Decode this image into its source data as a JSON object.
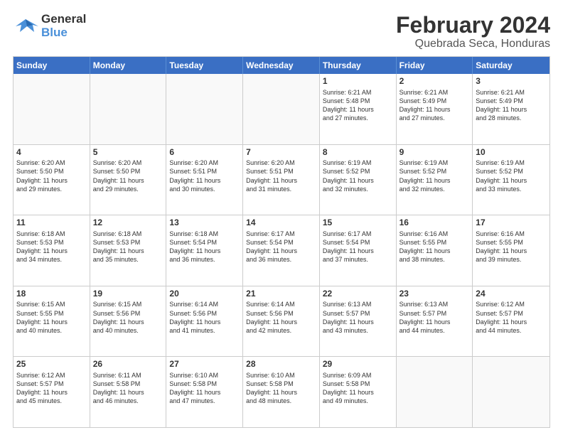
{
  "header": {
    "logo_line1": "General",
    "logo_line2": "Blue",
    "month": "February 2024",
    "location": "Quebrada Seca, Honduras"
  },
  "weekdays": [
    "Sunday",
    "Monday",
    "Tuesday",
    "Wednesday",
    "Thursday",
    "Friday",
    "Saturday"
  ],
  "weeks": [
    [
      {
        "day": "",
        "info": ""
      },
      {
        "day": "",
        "info": ""
      },
      {
        "day": "",
        "info": ""
      },
      {
        "day": "",
        "info": ""
      },
      {
        "day": "1",
        "info": "Sunrise: 6:21 AM\nSunset: 5:48 PM\nDaylight: 11 hours\nand 27 minutes."
      },
      {
        "day": "2",
        "info": "Sunrise: 6:21 AM\nSunset: 5:49 PM\nDaylight: 11 hours\nand 27 minutes."
      },
      {
        "day": "3",
        "info": "Sunrise: 6:21 AM\nSunset: 5:49 PM\nDaylight: 11 hours\nand 28 minutes."
      }
    ],
    [
      {
        "day": "4",
        "info": "Sunrise: 6:20 AM\nSunset: 5:50 PM\nDaylight: 11 hours\nand 29 minutes."
      },
      {
        "day": "5",
        "info": "Sunrise: 6:20 AM\nSunset: 5:50 PM\nDaylight: 11 hours\nand 29 minutes."
      },
      {
        "day": "6",
        "info": "Sunrise: 6:20 AM\nSunset: 5:51 PM\nDaylight: 11 hours\nand 30 minutes."
      },
      {
        "day": "7",
        "info": "Sunrise: 6:20 AM\nSunset: 5:51 PM\nDaylight: 11 hours\nand 31 minutes."
      },
      {
        "day": "8",
        "info": "Sunrise: 6:19 AM\nSunset: 5:52 PM\nDaylight: 11 hours\nand 32 minutes."
      },
      {
        "day": "9",
        "info": "Sunrise: 6:19 AM\nSunset: 5:52 PM\nDaylight: 11 hours\nand 32 minutes."
      },
      {
        "day": "10",
        "info": "Sunrise: 6:19 AM\nSunset: 5:52 PM\nDaylight: 11 hours\nand 33 minutes."
      }
    ],
    [
      {
        "day": "11",
        "info": "Sunrise: 6:18 AM\nSunset: 5:53 PM\nDaylight: 11 hours\nand 34 minutes."
      },
      {
        "day": "12",
        "info": "Sunrise: 6:18 AM\nSunset: 5:53 PM\nDaylight: 11 hours\nand 35 minutes."
      },
      {
        "day": "13",
        "info": "Sunrise: 6:18 AM\nSunset: 5:54 PM\nDaylight: 11 hours\nand 36 minutes."
      },
      {
        "day": "14",
        "info": "Sunrise: 6:17 AM\nSunset: 5:54 PM\nDaylight: 11 hours\nand 36 minutes."
      },
      {
        "day": "15",
        "info": "Sunrise: 6:17 AM\nSunset: 5:54 PM\nDaylight: 11 hours\nand 37 minutes."
      },
      {
        "day": "16",
        "info": "Sunrise: 6:16 AM\nSunset: 5:55 PM\nDaylight: 11 hours\nand 38 minutes."
      },
      {
        "day": "17",
        "info": "Sunrise: 6:16 AM\nSunset: 5:55 PM\nDaylight: 11 hours\nand 39 minutes."
      }
    ],
    [
      {
        "day": "18",
        "info": "Sunrise: 6:15 AM\nSunset: 5:55 PM\nDaylight: 11 hours\nand 40 minutes."
      },
      {
        "day": "19",
        "info": "Sunrise: 6:15 AM\nSunset: 5:56 PM\nDaylight: 11 hours\nand 40 minutes."
      },
      {
        "day": "20",
        "info": "Sunrise: 6:14 AM\nSunset: 5:56 PM\nDaylight: 11 hours\nand 41 minutes."
      },
      {
        "day": "21",
        "info": "Sunrise: 6:14 AM\nSunset: 5:56 PM\nDaylight: 11 hours\nand 42 minutes."
      },
      {
        "day": "22",
        "info": "Sunrise: 6:13 AM\nSunset: 5:57 PM\nDaylight: 11 hours\nand 43 minutes."
      },
      {
        "day": "23",
        "info": "Sunrise: 6:13 AM\nSunset: 5:57 PM\nDaylight: 11 hours\nand 44 minutes."
      },
      {
        "day": "24",
        "info": "Sunrise: 6:12 AM\nSunset: 5:57 PM\nDaylight: 11 hours\nand 44 minutes."
      }
    ],
    [
      {
        "day": "25",
        "info": "Sunrise: 6:12 AM\nSunset: 5:57 PM\nDaylight: 11 hours\nand 45 minutes."
      },
      {
        "day": "26",
        "info": "Sunrise: 6:11 AM\nSunset: 5:58 PM\nDaylight: 11 hours\nand 46 minutes."
      },
      {
        "day": "27",
        "info": "Sunrise: 6:10 AM\nSunset: 5:58 PM\nDaylight: 11 hours\nand 47 minutes."
      },
      {
        "day": "28",
        "info": "Sunrise: 6:10 AM\nSunset: 5:58 PM\nDaylight: 11 hours\nand 48 minutes."
      },
      {
        "day": "29",
        "info": "Sunrise: 6:09 AM\nSunset: 5:58 PM\nDaylight: 11 hours\nand 49 minutes."
      },
      {
        "day": "",
        "info": ""
      },
      {
        "day": "",
        "info": ""
      }
    ]
  ]
}
